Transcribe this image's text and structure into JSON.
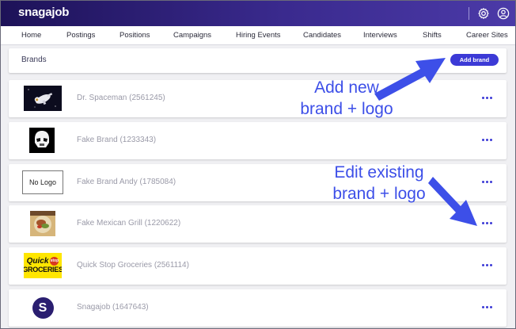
{
  "app": {
    "logo_text": "snagajob"
  },
  "header_icons": [
    "gear-icon",
    "user-account-icon"
  ],
  "nav": {
    "items": [
      {
        "label": "Home"
      },
      {
        "label": "Postings"
      },
      {
        "label": "Positions"
      },
      {
        "label": "Campaigns"
      },
      {
        "label": "Hiring Events"
      },
      {
        "label": "Candidates"
      },
      {
        "label": "Interviews"
      },
      {
        "label": "Shifts"
      },
      {
        "label": "Career Sites"
      }
    ]
  },
  "brands_header": {
    "title": "Brands",
    "add_button_label": "Add brand"
  },
  "brands": [
    {
      "name": "Dr. Spaceman (2561245)",
      "logo": "astronaut-image"
    },
    {
      "name": "Fake Brand (1233343)",
      "logo": "stormtrooper-image"
    },
    {
      "name": "Fake Brand Andy (1785084)",
      "logo": "no-logo-placeholder",
      "logo_text": "No Logo"
    },
    {
      "name": "Fake Mexican Grill (1220622)",
      "logo": "food-image"
    },
    {
      "name": "Quick Stop Groceries (2561114)",
      "logo": "quick-stop-logo",
      "logo_top": "Quick",
      "logo_badge": "stop",
      "logo_bottom": "GROCERIES"
    },
    {
      "name": "Snagajob (1647643)",
      "logo": "snagajob-logo",
      "logo_text": "S"
    }
  ],
  "annotations": {
    "add_new_line1": "Add new",
    "add_new_line2": "brand + logo",
    "edit_line1": "Edit existing",
    "edit_line2": "brand + logo"
  },
  "colors": {
    "accent": "#3c3ad6",
    "annotation": "#3d4fe8",
    "topbar_start": "#1d1258",
    "topbar_end": "#4b3aa8"
  }
}
